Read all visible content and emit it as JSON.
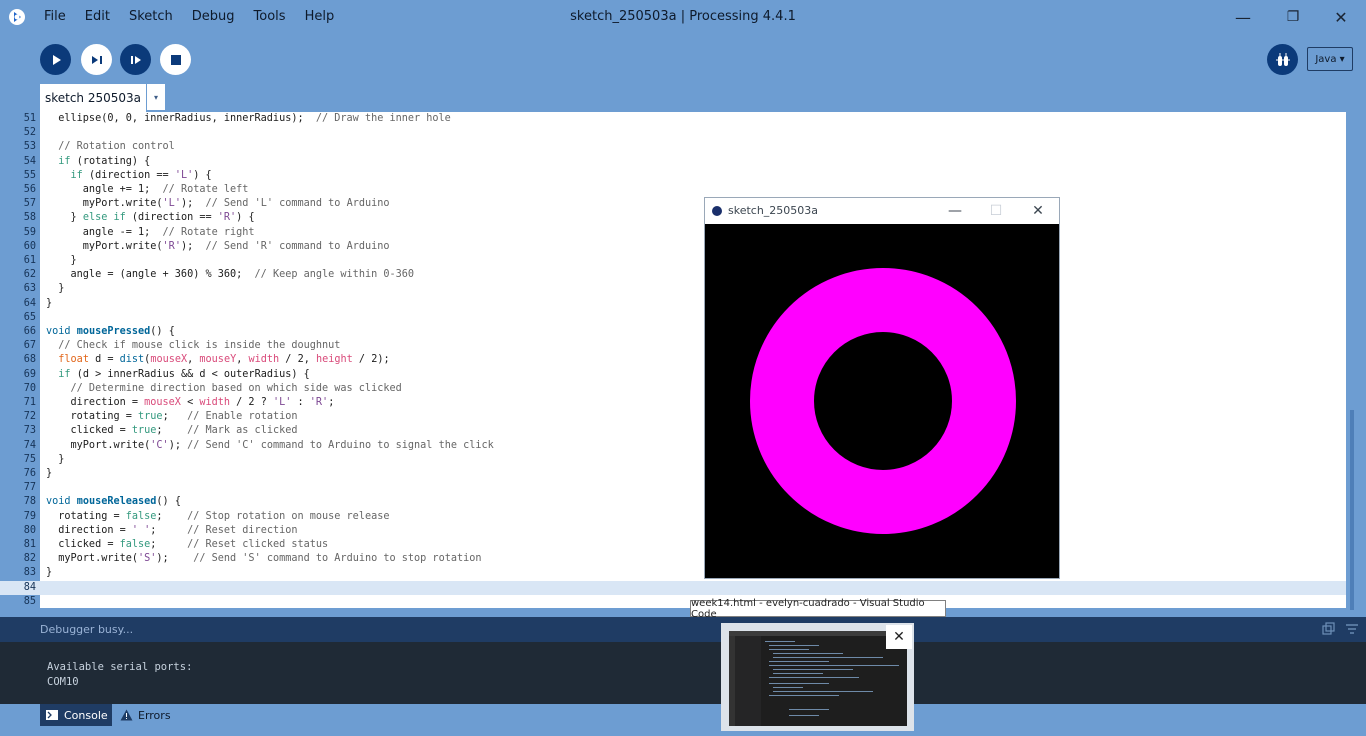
{
  "window": {
    "title": "sketch_250503a | Processing 4.4.1",
    "controls": [
      "—",
      "❐",
      "✕"
    ]
  },
  "menu": [
    "File",
    "Edit",
    "Sketch",
    "Debug",
    "Tools",
    "Help"
  ],
  "toolbar": {
    "run": "run-icon",
    "present": "present-icon",
    "step": "step-icon",
    "stop": "stop-icon",
    "debugger": "debugger-icon",
    "mode_label": "Java ▾"
  },
  "tab": {
    "label": "sketch 250503a",
    "menu_arrow": "▾"
  },
  "editor": {
    "current_line": 84,
    "lines": [
      {
        "n": "51",
        "segs": [
          [
            "",
            "  ellipse(0, 0, innerRadius, innerRadius);  "
          ],
          [
            "cm",
            "// Draw the inner hole"
          ]
        ]
      },
      {
        "n": "52",
        "segs": []
      },
      {
        "n": "53",
        "segs": [
          [
            "cm",
            "  // Rotation control"
          ]
        ]
      },
      {
        "n": "54",
        "segs": [
          [
            "",
            "  "
          ],
          [
            "kw",
            "if"
          ],
          [
            "",
            " (rotating) {"
          ]
        ]
      },
      {
        "n": "55",
        "segs": [
          [
            "",
            "    "
          ],
          [
            "kw",
            "if"
          ],
          [
            "",
            " (direction == "
          ],
          [
            "st",
            "'L'"
          ],
          [
            "",
            ") {"
          ]
        ]
      },
      {
        "n": "56",
        "segs": [
          [
            "",
            "      angle += 1;  "
          ],
          [
            "cm",
            "// Rotate left"
          ]
        ]
      },
      {
        "n": "57",
        "segs": [
          [
            "",
            "      myPort.write("
          ],
          [
            "st",
            "'L'"
          ],
          [
            "",
            ");  "
          ],
          [
            "cm",
            "// Send 'L' command to Arduino"
          ]
        ]
      },
      {
        "n": "58",
        "segs": [
          [
            "",
            "    } "
          ],
          [
            "kw",
            "else if"
          ],
          [
            "",
            " (direction == "
          ],
          [
            "st",
            "'R'"
          ],
          [
            "",
            ") {"
          ]
        ]
      },
      {
        "n": "59",
        "segs": [
          [
            "",
            "      angle -= 1;  "
          ],
          [
            "cm",
            "// Rotate right"
          ]
        ]
      },
      {
        "n": "60",
        "segs": [
          [
            "",
            "      myPort.write("
          ],
          [
            "st",
            "'R'"
          ],
          [
            "",
            ");  "
          ],
          [
            "cm",
            "// Send 'R' command to Arduino"
          ]
        ]
      },
      {
        "n": "61",
        "segs": [
          [
            "",
            "    }"
          ]
        ]
      },
      {
        "n": "62",
        "segs": [
          [
            "",
            "    angle = (angle + 360) % 360;  "
          ],
          [
            "cm",
            "// Keep angle within 0-360"
          ]
        ]
      },
      {
        "n": "63",
        "segs": [
          [
            "",
            "  }"
          ]
        ]
      },
      {
        "n": "64",
        "segs": [
          [
            "",
            "}"
          ]
        ]
      },
      {
        "n": "65",
        "segs": []
      },
      {
        "n": "66",
        "segs": [
          [
            "bl",
            "void"
          ],
          [
            "",
            " "
          ],
          [
            "fn",
            "mousePressed"
          ],
          [
            "",
            "() {"
          ]
        ]
      },
      {
        "n": "67",
        "segs": [
          [
            "cm",
            "  // Check if mouse click is inside the doughnut"
          ]
        ]
      },
      {
        "n": "68",
        "segs": [
          [
            "",
            "  "
          ],
          [
            "ty",
            "float"
          ],
          [
            "",
            " d = "
          ],
          [
            "bl",
            "dist"
          ],
          [
            "",
            "("
          ],
          [
            "bi",
            "mouseX"
          ],
          [
            "",
            ", "
          ],
          [
            "bi",
            "mouseY"
          ],
          [
            "",
            ", "
          ],
          [
            "bi",
            "width"
          ],
          [
            "",
            " / 2, "
          ],
          [
            "bi",
            "height"
          ],
          [
            "",
            " / 2);"
          ]
        ]
      },
      {
        "n": "69",
        "segs": [
          [
            "",
            "  "
          ],
          [
            "kw",
            "if"
          ],
          [
            "",
            " (d > innerRadius && d < outerRadius) {"
          ]
        ]
      },
      {
        "n": "70",
        "segs": [
          [
            "cm",
            "    // Determine direction based on which side was clicked"
          ]
        ]
      },
      {
        "n": "71",
        "segs": [
          [
            "",
            "    direction = "
          ],
          [
            "bi",
            "mouseX"
          ],
          [
            "",
            " < "
          ],
          [
            "bi",
            "width"
          ],
          [
            "",
            " / 2 ? "
          ],
          [
            "st",
            "'L'"
          ],
          [
            "",
            " : "
          ],
          [
            "st",
            "'R'"
          ],
          [
            "",
            ";"
          ]
        ]
      },
      {
        "n": "72",
        "segs": [
          [
            "",
            "    rotating = "
          ],
          [
            "kw",
            "true"
          ],
          [
            "",
            ";   "
          ],
          [
            "cm",
            "// Enable rotation"
          ]
        ]
      },
      {
        "n": "73",
        "segs": [
          [
            "",
            "    clicked = "
          ],
          [
            "kw",
            "true"
          ],
          [
            "",
            ";    "
          ],
          [
            "cm",
            "// Mark as clicked"
          ]
        ]
      },
      {
        "n": "74",
        "segs": [
          [
            "",
            "    myPort.write("
          ],
          [
            "st",
            "'C'"
          ],
          [
            "",
            "); "
          ],
          [
            "cm",
            "// Send 'C' command to Arduino to signal the click"
          ]
        ]
      },
      {
        "n": "75",
        "segs": [
          [
            "",
            "  }"
          ]
        ]
      },
      {
        "n": "76",
        "segs": [
          [
            "",
            "}"
          ]
        ]
      },
      {
        "n": "77",
        "segs": []
      },
      {
        "n": "78",
        "segs": [
          [
            "bl",
            "void"
          ],
          [
            "",
            " "
          ],
          [
            "fn",
            "mouseReleased"
          ],
          [
            "",
            "() {"
          ]
        ]
      },
      {
        "n": "79",
        "segs": [
          [
            "",
            "  rotating = "
          ],
          [
            "kw",
            "false"
          ],
          [
            "",
            ";    "
          ],
          [
            "cm",
            "// Stop rotation on mouse release"
          ]
        ]
      },
      {
        "n": "80",
        "segs": [
          [
            "",
            "  direction = "
          ],
          [
            "st",
            "' '"
          ],
          [
            "",
            ";     "
          ],
          [
            "cm",
            "// Reset direction"
          ]
        ]
      },
      {
        "n": "81",
        "segs": [
          [
            "",
            "  clicked = "
          ],
          [
            "kw",
            "false"
          ],
          [
            "",
            ";     "
          ],
          [
            "cm",
            "// Reset clicked status"
          ]
        ]
      },
      {
        "n": "82",
        "segs": [
          [
            "",
            "  myPort.write("
          ],
          [
            "st",
            "'S'"
          ],
          [
            "",
            ");    "
          ],
          [
            "cm",
            "// Send 'S' command to Arduino to stop rotation"
          ]
        ]
      },
      {
        "n": "83",
        "segs": [
          [
            "",
            "}"
          ]
        ]
      },
      {
        "n": "84",
        "segs": []
      },
      {
        "n": "85",
        "segs": []
      }
    ]
  },
  "status": {
    "text": "Debugger busy..."
  },
  "console": {
    "lines": [
      "Available serial ports:",
      "COM10"
    ]
  },
  "bottom_tabs": {
    "console": "Console",
    "errors": "Errors"
  },
  "sketch_window": {
    "title": "sketch_250503a",
    "controls": [
      "—",
      "☐",
      "✕"
    ],
    "canvas_bg": "#000000",
    "doughnut_color": "#ff00ff"
  },
  "taskbar_preview": {
    "tooltip": "week14.html - evelyn-cuadrado - Visual Studio Code",
    "close": "✕"
  },
  "colors": {
    "chrome": "#6d9dd2",
    "button_dark": "#0b3a7a",
    "console_bg": "#1f2a36"
  }
}
